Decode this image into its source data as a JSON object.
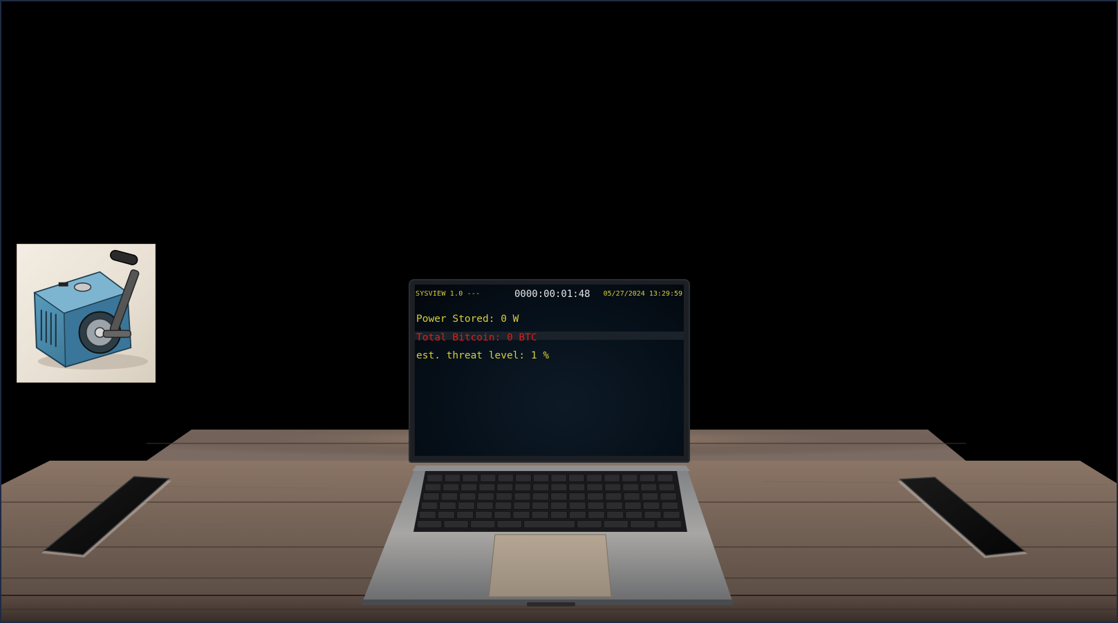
{
  "terminal": {
    "title": "SYSVIEW 1.0 ---",
    "timer": "0000:00:01:48",
    "datetime": "05/27/2024 13:29:59",
    "power_stored": "Power Stored: 0 W",
    "total_bitcoin": "Total Bitcoin: 0 BTC",
    "threat_level": "est. threat level: 1 %"
  },
  "colors": {
    "terminal_yellow": "#d6cf3a",
    "terminal_red": "#e01b1b",
    "terminal_white": "#e6e6e6",
    "generator_blue": "#3e7fa3"
  },
  "icons": {
    "generator": "hand-crank-generator-icon"
  }
}
